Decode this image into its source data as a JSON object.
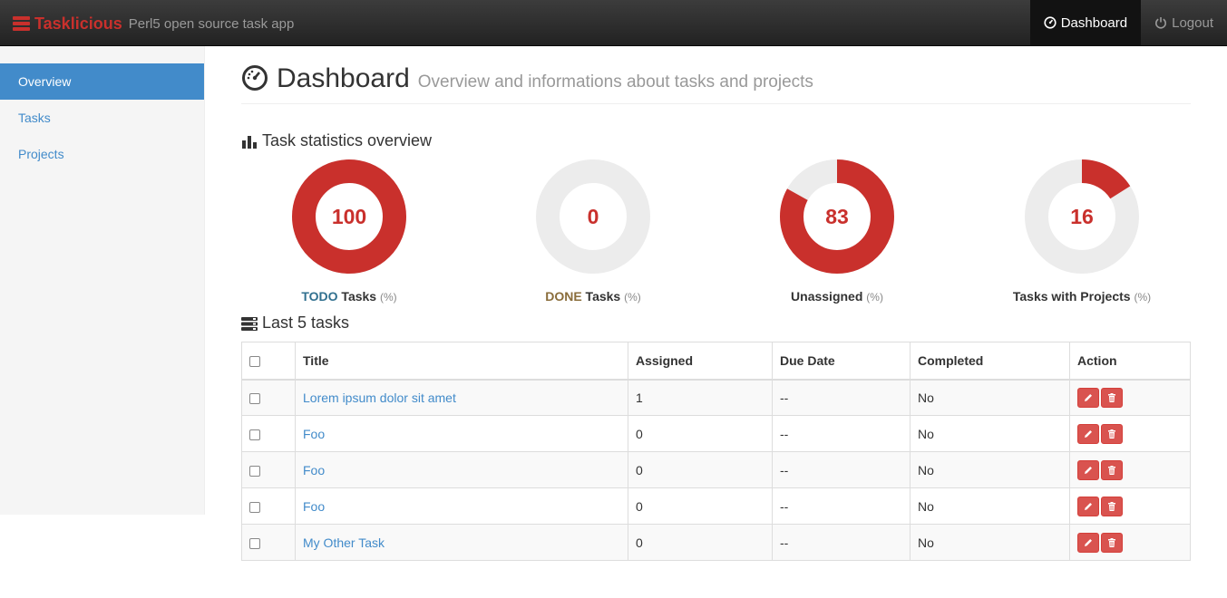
{
  "navbar": {
    "brand": "Tasklicious",
    "tagline": "Perl5 open source task app",
    "items": [
      {
        "label": "Dashboard",
        "icon": "dashboard-icon"
      },
      {
        "label": "Logout",
        "icon": "power-icon"
      }
    ]
  },
  "sidebar": {
    "items": [
      {
        "label": "Overview"
      },
      {
        "label": "Tasks"
      },
      {
        "label": "Projects"
      }
    ]
  },
  "header": {
    "title": "Dashboard",
    "subtitle": "Overview and informations about tasks and projects"
  },
  "stats_section": {
    "title": "Task statistics overview",
    "icon": "bar-chart-icon",
    "items": [
      {
        "value": "100",
        "percent": 100,
        "label_prefix": "TODO",
        "label": " Tasks",
        "pct": "(%)"
      },
      {
        "value": "0",
        "percent": 0,
        "label_prefix": "DONE",
        "label": " Tasks",
        "pct": "(%)"
      },
      {
        "value": "83",
        "percent": 83,
        "label_prefix": "",
        "label": "Unassigned",
        "pct": "(%)"
      },
      {
        "value": "16",
        "percent": 16,
        "label_prefix": "",
        "label": "Tasks with Projects",
        "pct": "(%)"
      }
    ]
  },
  "tasks_section": {
    "title": "Last 5 tasks",
    "icon": "tasks-icon",
    "columns": [
      "Title",
      "Assigned",
      "Due Date",
      "Completed",
      "Action"
    ],
    "rows": [
      {
        "title": "Lorem ipsum dolor sit amet",
        "assigned": "1",
        "due": "--",
        "completed": "No"
      },
      {
        "title": "Foo",
        "assigned": "0",
        "due": "--",
        "completed": "No"
      },
      {
        "title": "Foo",
        "assigned": "0",
        "due": "--",
        "completed": "No"
      },
      {
        "title": "Foo",
        "assigned": "0",
        "due": "--",
        "completed": "No"
      },
      {
        "title": "My Other Task",
        "assigned": "0",
        "due": "--",
        "completed": "No"
      }
    ]
  },
  "colors": {
    "accent": "#c9302c",
    "link": "#428bca",
    "ring_bg": "#ececec"
  }
}
